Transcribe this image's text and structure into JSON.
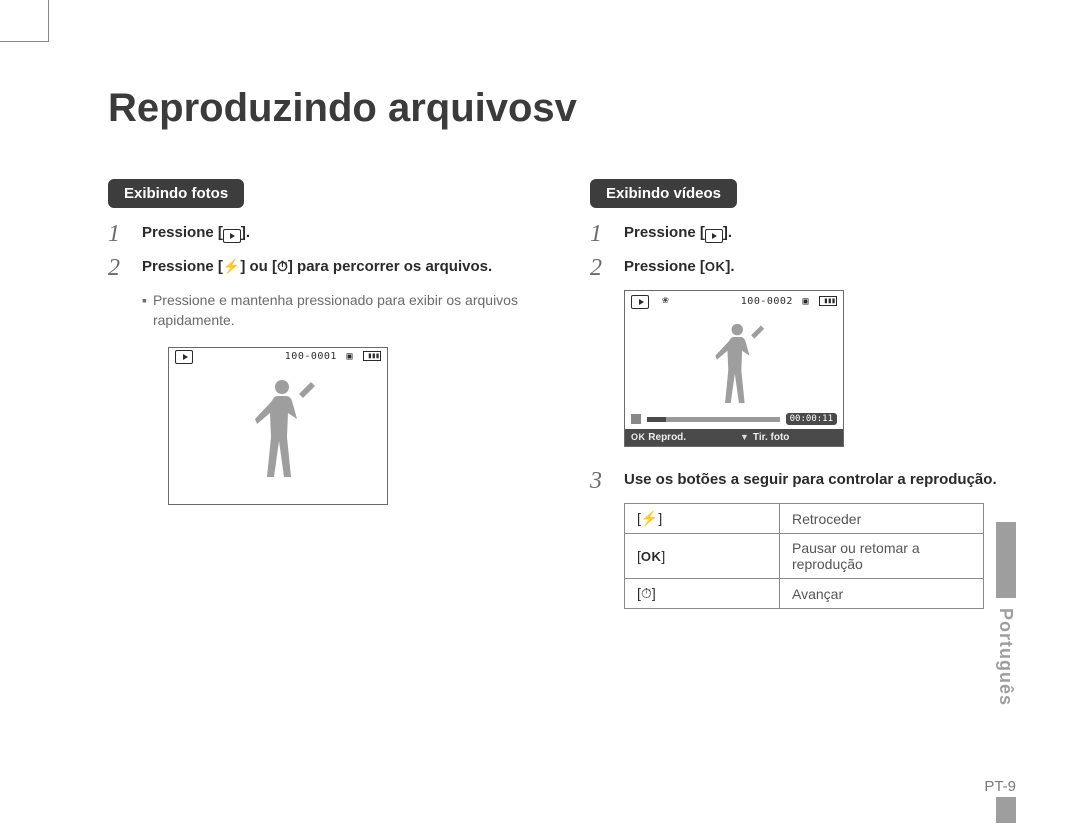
{
  "page": {
    "title": "Reproduzindo arquivosv",
    "language_tab": "Português",
    "page_number": "PT-9"
  },
  "left": {
    "pill": "Exibindo fotos",
    "step1": "Pressione [",
    "step1_after": "].",
    "step2_a": "Pressione [",
    "step2_b": "] ou [",
    "step2_c": "] para percorrer os arquivos.",
    "sub_bullet": "▪",
    "sub_note": "Pressione e mantenha pressionado para exibir os arquivos rapidamente.",
    "lcd_file": "100-0001"
  },
  "right": {
    "pill": "Exibindo vídeos",
    "step1": "Pressione [",
    "step1_after": "].",
    "step2": "Pressione [",
    "step2_after": "].",
    "lcd_file": "100-0002",
    "lcd_time": "00:00:11",
    "lcd_btn_ok": "OK",
    "lcd_btn_left": "Reprod.",
    "lcd_btn_right": "Tir. foto",
    "step3": "Use os botões a seguir para controlar a reprodução.",
    "table": [
      {
        "key_pre": "[",
        "key_icon": "flash",
        "key_post": "]",
        "val": "Retroceder"
      },
      {
        "key_pre": "[",
        "key_icon": "ok",
        "key_post": "]",
        "val": "Pausar ou retomar a reprodução"
      },
      {
        "key_pre": "[",
        "key_icon": "timer",
        "key_post": "]",
        "val": "Avançar"
      }
    ]
  }
}
